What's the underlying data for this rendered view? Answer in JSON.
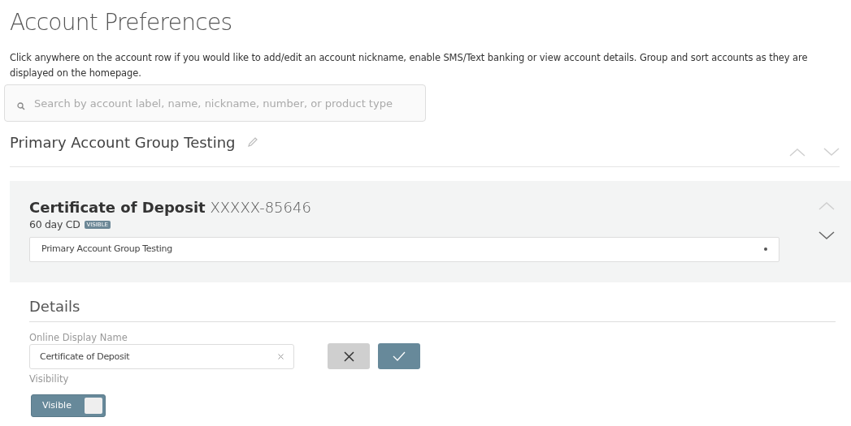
{
  "title": "Account Preferences",
  "description": "Click anywhere on the account row if you would like to add/edit an account nickname, enable SMS/Text banking or view account details. Group and sort accounts as they are displayed on the homepage.",
  "search": {
    "placeholder": "Search by account label, name, nickname, number, or product type"
  },
  "group": {
    "name": "Primary Account Group Testing",
    "move_up_disabled": true,
    "move_down_disabled": true
  },
  "account": {
    "name": "Certificate of Deposit",
    "number": "XXXXX-85646",
    "product": "60 day CD",
    "badge": "VISIBLE",
    "group_select": {
      "value": "Primary Account Group Testing"
    },
    "move_up_disabled": true,
    "move_down_disabled": false
  },
  "details": {
    "heading": "Details",
    "display_name": {
      "label": "Online Display Name",
      "value": "Certificate of Deposit"
    },
    "visibility": {
      "label": "Visibility",
      "toggle_label": "Visible",
      "on": true
    }
  }
}
